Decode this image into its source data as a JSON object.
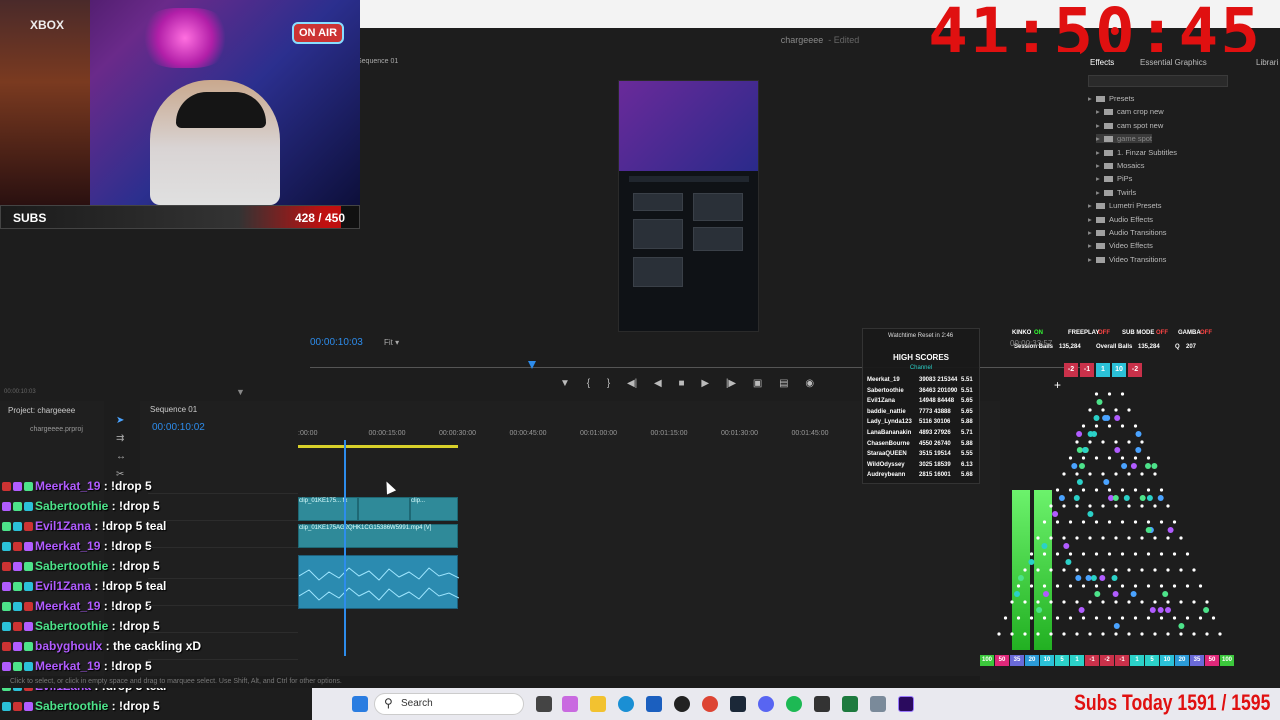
{
  "overlay": {
    "clock": "41:50:45",
    "subs_label": "SUBS",
    "subs_count": "428 / 450",
    "subs_fraction": 0.951,
    "subs_today": "Subs Today 1591 / 1595",
    "cam_xbox": "XBOX",
    "cam_onair": "ON AIR"
  },
  "premiere": {
    "window_title": "chargeeee",
    "window_status": "- Edited",
    "sequence_tab_top": "Sequence 01",
    "program_timecode": "00:00:10:03",
    "fit_label": "Fit",
    "left_timecode": "00:00:10:03",
    "project_tab": "Project: chargeeee",
    "project_file": "chargeeee.prproj",
    "timeline_tab": "Sequence 01",
    "timeline_timecode": "00:00:10:02",
    "ruler": [
      ":00:00",
      "00:00:15:00",
      "00:00:30:00",
      "00:00:45:00",
      "00:01:00:00",
      "00:01:15:00",
      "00:01:30:00",
      "00:01:45:00",
      "00:02:0"
    ],
    "clip_v2_a": "clip_01KE175...",
    "clip_v2_b": "clip...",
    "clip_v1": "clip_01KE175AG2QHK1CG15386W5991.mp4 [V]",
    "fx": "fx",
    "status_text": "Click to select, or click in empty space and drag to marquee select. Use Shift, Alt, and Ctrl for other options.",
    "effects": {
      "tab_effects": "Effects",
      "tab_essential": "Essential Graphics",
      "tab_libraries": "Librari",
      "tree": [
        {
          "label": "Presets",
          "depth": 1
        },
        {
          "label": "cam crop new",
          "depth": 2
        },
        {
          "label": "cam spot new",
          "depth": 2
        },
        {
          "label": "game spot",
          "depth": 2
        },
        {
          "label": "1. Finzar Subtitles",
          "depth": 2
        },
        {
          "label": "Mosaics",
          "depth": 2
        },
        {
          "label": "PiPs",
          "depth": 2
        },
        {
          "label": "Twirls",
          "depth": 2
        },
        {
          "label": "Lumetri Presets",
          "depth": 1
        },
        {
          "label": "Audio Effects",
          "depth": 1
        },
        {
          "label": "Audio Transitions",
          "depth": 1
        },
        {
          "label": "Video Effects",
          "depth": 1
        },
        {
          "label": "Video Transitions",
          "depth": 1
        }
      ]
    }
  },
  "scores": {
    "watchtime": "Watchtime Reset in 2:46",
    "title": "HIGH SCORES",
    "channel": "Channel",
    "rows": [
      {
        "name": "Meerkat_19",
        "score": "39083 215344",
        "mult": "5.51"
      },
      {
        "name": "Sabertoothie",
        "score": "36463 201090",
        "mult": "5.51"
      },
      {
        "name": "Evil1Zana",
        "score": "14948 84448",
        "mult": "5.65"
      },
      {
        "name": "baddie_nattie",
        "score": "7773 43888",
        "mult": "5.65"
      },
      {
        "name": "Lady_Lynda123",
        "score": "5116 30106",
        "mult": "5.88"
      },
      {
        "name": "LanaBananakin",
        "score": "4893 27926",
        "mult": "5.71"
      },
      {
        "name": "ChasenBourne",
        "score": "4550 26740",
        "mult": "5.88"
      },
      {
        "name": "StaraaQUEEN",
        "score": "3515 19514",
        "mult": "5.55"
      },
      {
        "name": "WildOdyssey",
        "score": "3025 18539",
        "mult": "6.13"
      },
      {
        "name": "Audreybeann",
        "score": "2815 16001",
        "mult": "5.68"
      }
    ]
  },
  "stats": {
    "kinko": "KINKO",
    "kinko_val": "ON",
    "freeplay": "FREEPLAY",
    "freeplay_val": "OFF",
    "submode": "SUB MODE",
    "submode_val": "OFF",
    "gamba": "GAMBA",
    "gamba_val": "OFF",
    "session_balls": "Session Balls",
    "session_val": "135,284",
    "overall_balls": "Overall Balls",
    "overall_val": "135,284",
    "q": "Q",
    "q_val": "207",
    "timer": "00:00:33:57",
    "multipliers": [
      "-2",
      "-1",
      "1",
      "10",
      "-2"
    ]
  },
  "plinko_slots": [
    "100",
    "50",
    "35",
    "20",
    "10",
    "5",
    "1",
    "-1",
    "-2",
    "-1",
    "1",
    "5",
    "10",
    "20",
    "35",
    "50",
    "100"
  ],
  "chat": [
    {
      "user": "Meerkat_19",
      "msg": " : !drop 5",
      "color": "#b15cff"
    },
    {
      "user": "Sabertoothie",
      "msg": " : !drop 5",
      "color": "#4de38a"
    },
    {
      "user": "Evil1Zana",
      "msg": " : !drop 5 teal",
      "color": "#b15cff"
    },
    {
      "user": "Meerkat_19",
      "msg": " : !drop 5",
      "color": "#b15cff"
    },
    {
      "user": "Sabertoothie",
      "msg": " : !drop 5",
      "color": "#4de38a"
    },
    {
      "user": "Evil1Zana",
      "msg": " : !drop 5 teal",
      "color": "#b15cff"
    },
    {
      "user": "Meerkat_19",
      "msg": " : !drop 5",
      "color": "#b15cff"
    },
    {
      "user": "Sabertoothie",
      "msg": " : !drop 5",
      "color": "#4de38a"
    },
    {
      "user": "babyghoulx",
      "msg": " : the cackling xD",
      "color": "#b15cff"
    },
    {
      "user": "Meerkat_19",
      "msg": " : !drop 5",
      "color": "#b15cff"
    },
    {
      "user": "Evil1Zana",
      "msg": " : !drop 5 teal",
      "color": "#b15cff"
    },
    {
      "user": "Sabertoothie",
      "msg": " : !drop 5",
      "color": "#4de38a"
    }
  ],
  "taskbar": {
    "search_placeholder": "Search"
  }
}
